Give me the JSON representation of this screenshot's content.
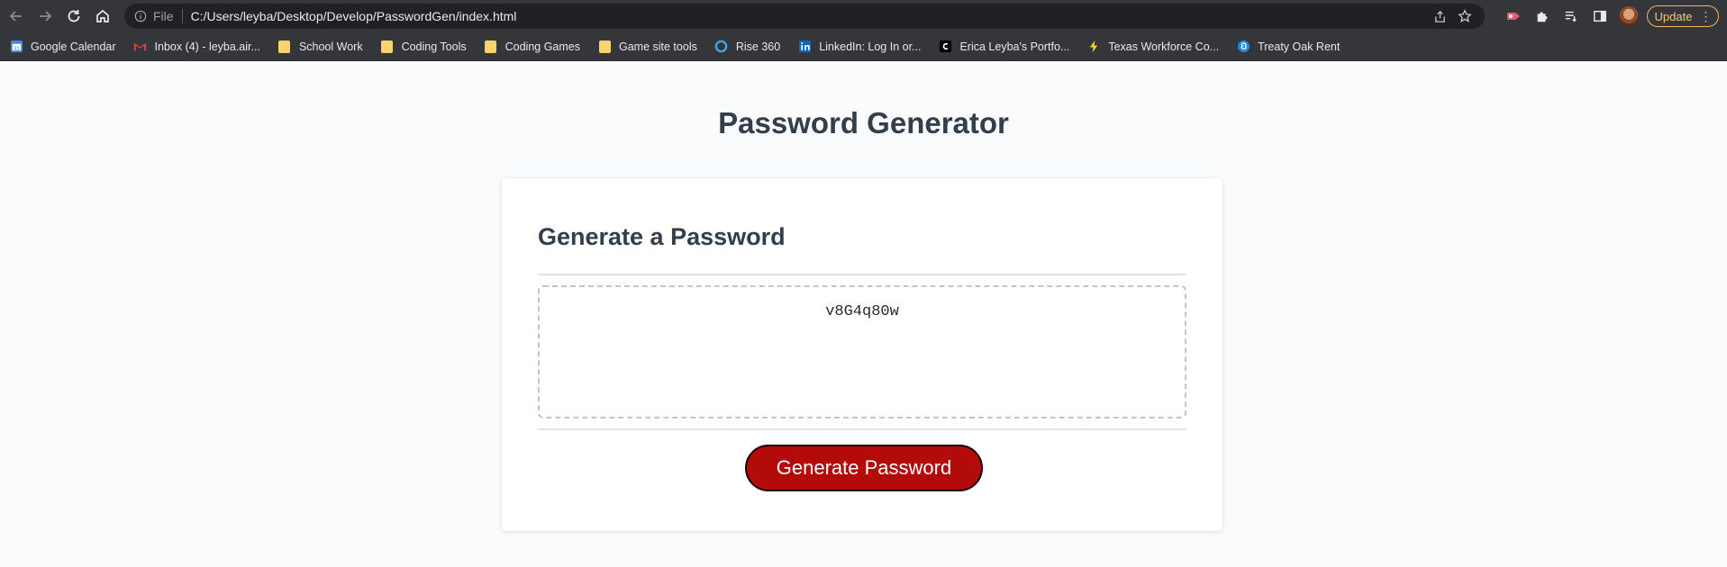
{
  "browser": {
    "scheme_label": "File",
    "url": "C:/Users/leyba/Desktop/Develop/PasswordGen/index.html",
    "update_label": "Update",
    "bookmarks": [
      {
        "label": "Google Calendar",
        "icon": "calendar-icon"
      },
      {
        "label": "Inbox (4) - leyba.air...",
        "icon": "gmail-icon"
      },
      {
        "label": "School Work",
        "icon": "folder-icon"
      },
      {
        "label": "Coding Tools",
        "icon": "folder-icon"
      },
      {
        "label": "Coding Games",
        "icon": "folder-icon"
      },
      {
        "label": "Game site tools",
        "icon": "folder-icon"
      },
      {
        "label": "Rise 360",
        "icon": "rise-icon"
      },
      {
        "label": "LinkedIn: Log In or...",
        "icon": "linkedin-icon"
      },
      {
        "label": "Erica Leyba's Portfo...",
        "icon": "portfolio-icon"
      },
      {
        "label": "Texas Workforce Co...",
        "icon": "bolt-icon"
      },
      {
        "label": "Treaty Oak Rent",
        "icon": "rent-icon"
      }
    ]
  },
  "page": {
    "title": "Password Generator",
    "card_header": "Generate a Password",
    "password_value": "v8G4q80w",
    "button_label": "Generate Password"
  },
  "colors": {
    "chrome_bg": "#35363a",
    "button_bg": "#b30a0a",
    "heading": "#333e4b"
  }
}
